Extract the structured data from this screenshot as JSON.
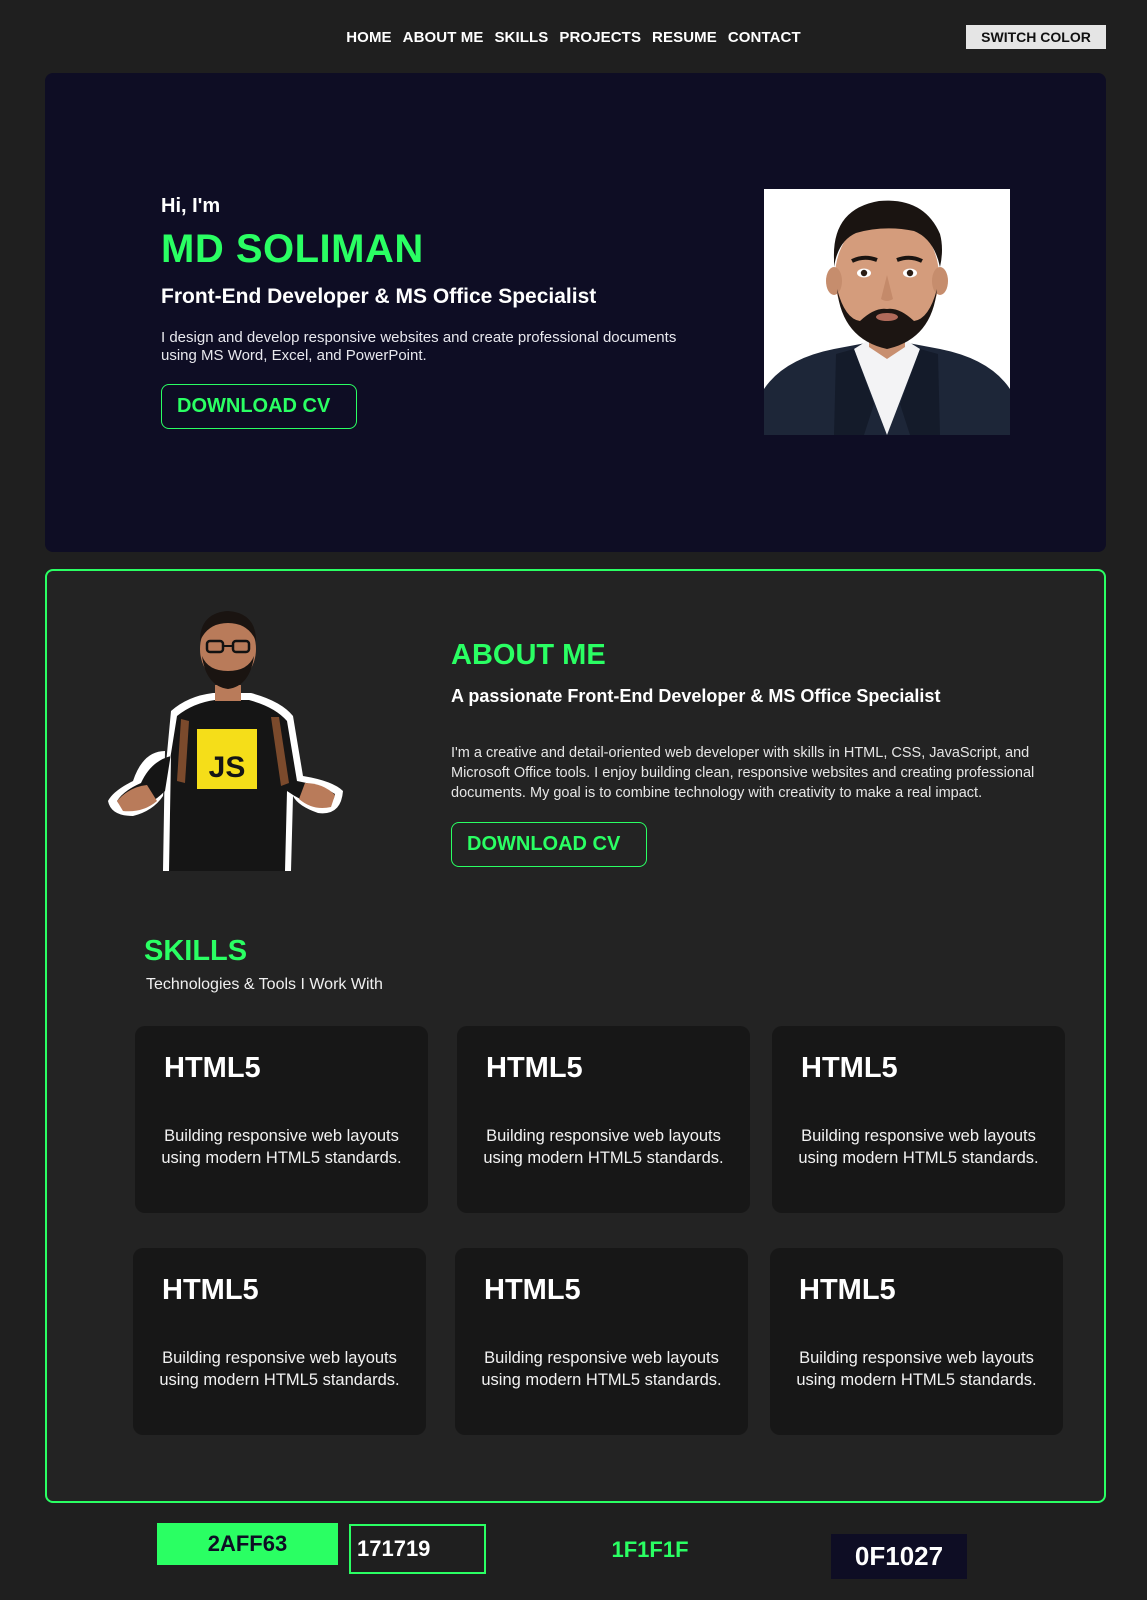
{
  "nav": {
    "items": [
      "HOME",
      "ABOUT ME",
      "SKILLS",
      "PROJECTS",
      "RESUME",
      "CONTACT"
    ],
    "switch_color_label": "SWITCH COLOR"
  },
  "hero": {
    "greeting": "Hi, I'm",
    "name": "MD SOLIMAN",
    "role": "Front-End Developer & MS Office Specialist",
    "description": "I design and develop responsive websites and create professional documents\n using MS Word, Excel, and PowerPoint.",
    "cv_button": "DOWNLOAD CV"
  },
  "about": {
    "title": "ABOUT ME",
    "subtitle": "A passionate Front-End Developer & MS Office Specialist",
    "text": "I'm a creative and detail-oriented web developer with skills in HTML, CSS, JavaScript, and\nMicrosoft Office tools. I enjoy building clean, responsive websites and creating professional\ndocuments. My goal is to combine technology  with creativity to make a real impact.",
    "cv_button": "DOWNLOAD CV",
    "shirt_logo": "JS"
  },
  "skills": {
    "title": "SKILLS",
    "subtitle": "Technologies & Tools I Work With",
    "cards": [
      {
        "name": "HTML5",
        "desc": "Building responsive web layouts\nusing modern HTML5 standards."
      },
      {
        "name": "HTML5",
        "desc": "Building responsive web layouts\nusing modern HTML5 standards."
      },
      {
        "name": "HTML5",
        "desc": "Building responsive web layouts\nusing modern HTML5 standards."
      },
      {
        "name": "HTML5",
        "desc": "Building responsive web layouts\nusing modern HTML5 standards."
      },
      {
        "name": "HTML5",
        "desc": "Building responsive web layouts\nusing modern HTML5 standards."
      },
      {
        "name": "HTML5",
        "desc": "Building responsive web layouts\nusing modern HTML5 standards."
      }
    ]
  },
  "swatches": [
    "2AFF63",
    "171719",
    "1F1F1F",
    "0F1027"
  ],
  "colors": {
    "accent": "#2aff63",
    "hero_bg": "#0e0d24",
    "page_bg": "#1f1f1f",
    "card_bg": "#171717"
  }
}
